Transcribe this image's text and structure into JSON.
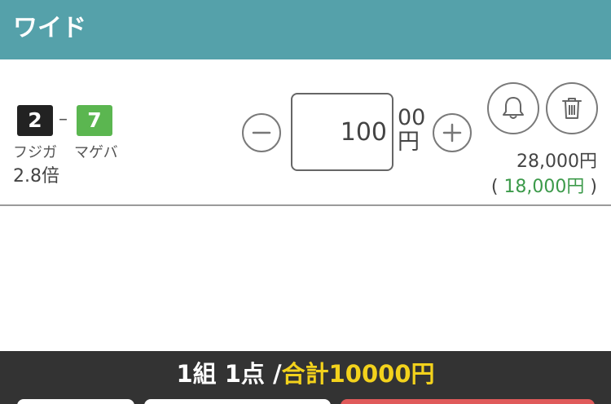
{
  "header": {
    "title": "ワイド"
  },
  "bet": {
    "frame1": "2",
    "frame2": "7",
    "separator": "–",
    "horse1": "フジガ",
    "horse2": "マゲバ",
    "odds": "2.8倍",
    "amount": "100",
    "unit_00": "00",
    "unit_yen": "円",
    "payout": "28,000円",
    "sub_payout_open": "( ",
    "sub_payout_value": "18,000円",
    "sub_payout_close": " )"
  },
  "footer": {
    "summary_prefix": "1組 1点 /",
    "summary_total": "合計10000円"
  },
  "colors": {
    "header": "#55a1aa",
    "frame1": "#222222",
    "frame2": "#5bb650",
    "sub_payout": "#3c9a4a",
    "footer": "#333333",
    "total_highlight": "#f3d21c",
    "primary_button": "#e05a5a"
  },
  "icons": [
    "minus-icon",
    "plus-icon",
    "bell-icon",
    "trash-icon"
  ]
}
